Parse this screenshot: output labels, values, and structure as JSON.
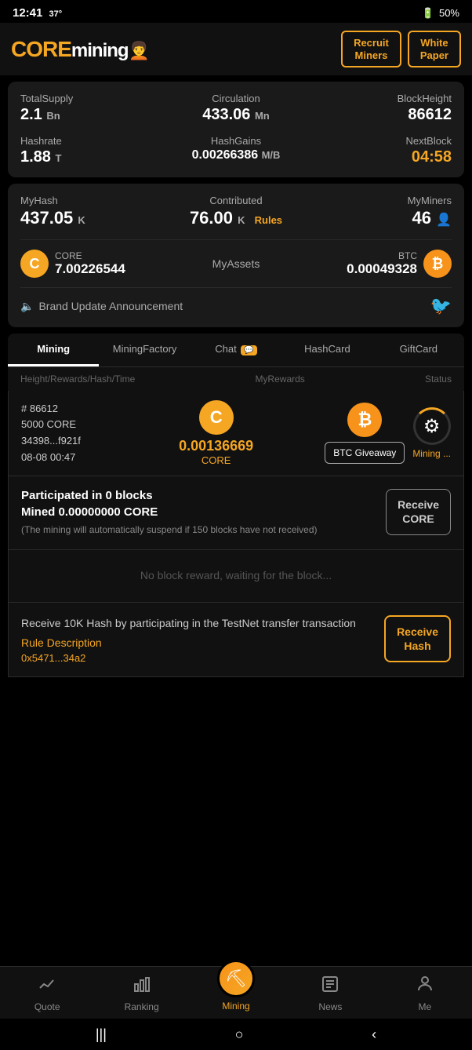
{
  "statusBar": {
    "time": "12:41",
    "temp": "37°",
    "battery": "50%"
  },
  "header": {
    "logoCore": "CORE",
    "logoMining": "mining",
    "recruitMiners": "Recruit\nMiners",
    "whitePaper": "White\nPaper"
  },
  "stats": {
    "totalSupplyLabel": "TotalSupply",
    "totalSupplyValue": "2.1",
    "totalSupplyUnit": "Bn",
    "circulationLabel": "Circulation",
    "circulationValue": "433.06",
    "circulationUnit": "Mn",
    "blockHeightLabel": "BlockHeight",
    "blockHeightValue": "86612",
    "hashrateLabel": "Hashrate",
    "hashrateValue": "1.88",
    "hashrateUnit": "T",
    "hashGainsLabel": "HashGains",
    "hashGainsValue": "0.00266386",
    "hashGainsUnit": "M/B",
    "nextBlockLabel": "NextBlock",
    "nextBlockValue": "04:58"
  },
  "myHash": {
    "myHashLabel": "MyHash",
    "myHashValue": "437.05",
    "myHashUnit": "K",
    "contributedLabel": "Contributed",
    "contributedValue": "76.00",
    "contributedUnit": "K",
    "rulesLabel": "Rules",
    "myMinersLabel": "MyMiners",
    "myMinersValue": "46"
  },
  "assets": {
    "coreLabel": "CORE",
    "coreAmount": "7.00226544",
    "myAssetsLabel": "MyAssets",
    "btcLabel": "BTC",
    "btcAmount": "0.00049328"
  },
  "announcement": {
    "text": "Brand Update Announcement"
  },
  "tabs": [
    {
      "label": "Mining",
      "active": true,
      "badge": ""
    },
    {
      "label": "MiningFactory",
      "active": false,
      "badge": ""
    },
    {
      "label": "Chat",
      "active": false,
      "badge": "💬"
    },
    {
      "label": "HashCard",
      "active": false,
      "badge": ""
    },
    {
      "label": "GiftCard",
      "active": false,
      "badge": ""
    }
  ],
  "tableHeader": {
    "col1": "Height/Rewards/Hash/Time",
    "col2": "MyRewards",
    "col3": "Status"
  },
  "miningBlock": {
    "height": "# 86612",
    "rewards": "5000 CORE",
    "hash": "34398...f921f",
    "time": "08-08 00:47",
    "coreAmount": "0.00136669",
    "coreLabel": "CORE",
    "btcGiveaway": "BTC Giveaway",
    "statusLabel": "Mining ..."
  },
  "participated": {
    "title": "Participated in 0 blocks",
    "mined": "Mined 0.00000000 CORE",
    "note": "(The mining will automatically suspend if 150 blocks have not received)",
    "receiveBtn": "Receive\nCORE"
  },
  "noReward": {
    "text": "No block reward, waiting for the block..."
  },
  "receiveHash": {
    "desc": "Receive 10K Hash by participating in the TestNet transfer transaction",
    "ruleLabel": "Rule Description",
    "address": "0x5471...34a2",
    "btnLabel": "Receive\nHash"
  },
  "bottomNav": [
    {
      "label": "Quote",
      "icon": "📈",
      "active": false
    },
    {
      "label": "Ranking",
      "icon": "📊",
      "active": false
    },
    {
      "label": "Mining",
      "icon": "⛏",
      "active": true,
      "special": true
    },
    {
      "label": "News",
      "icon": "📋",
      "active": false
    },
    {
      "label": "Me",
      "icon": "👤",
      "active": false
    }
  ],
  "androidNav": {
    "back": "|||",
    "home": "○",
    "recent": "‹"
  }
}
